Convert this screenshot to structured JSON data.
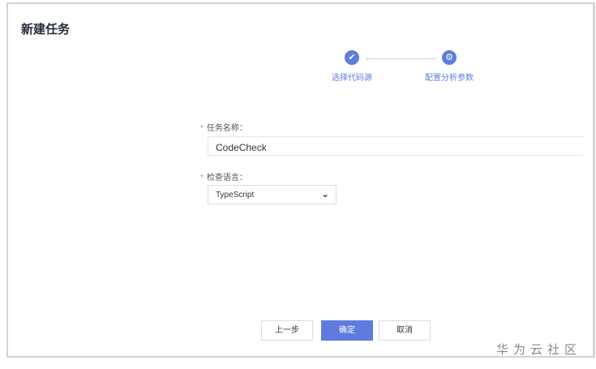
{
  "title": "新建任务",
  "steps": [
    {
      "label": "选择代码源",
      "icon": "check-icon"
    },
    {
      "label": "配置分析参数",
      "icon": "gear-icon"
    }
  ],
  "form": {
    "required_mark": "*",
    "name_label": "任务名称：",
    "name_value": "CodeCheck",
    "lang_label": "检查语言：",
    "lang_value": "TypeScript"
  },
  "buttons": {
    "prev": "上一步",
    "ok": "确定",
    "cancel": "取消"
  },
  "watermark": "华为云社区",
  "colors": {
    "accent": "#5e7ce0",
    "required": "#f66f6a"
  }
}
